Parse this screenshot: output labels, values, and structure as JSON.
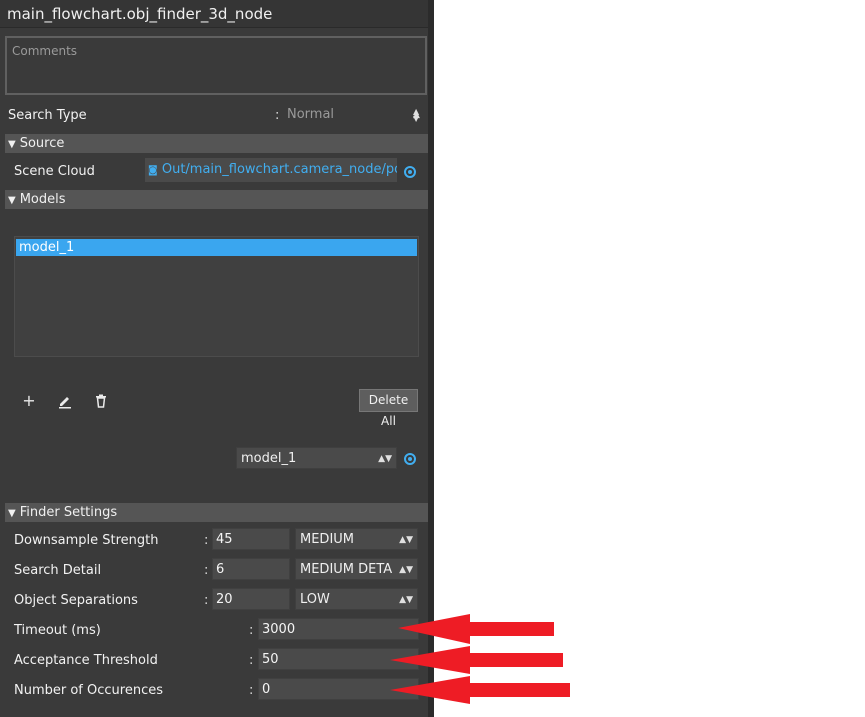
{
  "window": {
    "title": "main_flowchart.obj_finder_3d_node"
  },
  "comments": {
    "placeholder": "Comments"
  },
  "search_type": {
    "label": "Search Type",
    "value": "Normal"
  },
  "source": {
    "section_label": "Source",
    "scene_cloud": {
      "label": "Scene Cloud",
      "value": "Out/main_flowchart.camera_node/pointC"
    }
  },
  "models": {
    "section_label": "Models",
    "items": [
      "model_1"
    ],
    "delete_all_label": "Delete All",
    "selected_model": "model_1"
  },
  "finder_settings": {
    "section_label": "Finder Settings",
    "downsample_strength": {
      "label": "Downsample Strength",
      "value": "45",
      "level": "MEDIUM"
    },
    "search_detail": {
      "label": "Search Detail",
      "value": "6",
      "level": "MEDIUM DETA"
    },
    "object_separations": {
      "label": "Object Separations",
      "value": "20",
      "level": "LOW"
    },
    "timeout": {
      "label": "Timeout (ms)",
      "value": "3000"
    },
    "acceptance_threshold": {
      "label": "Acceptance Threshold",
      "value": "50"
    },
    "number_of_occurences": {
      "label": "Number of Occurences",
      "value": "0"
    }
  },
  "colors": {
    "panel_bg": "#3a3a3a",
    "section_bg": "#555555",
    "accent": "#41aef0",
    "selection": "#3aa6ef",
    "annotation_arrow": "#ee1c25"
  },
  "icons": {
    "add": "plus-icon",
    "edit": "pencil-icon",
    "delete": "trash-icon",
    "link": "camera-icon",
    "target": "target-icon",
    "expand": "triangle-down-icon"
  }
}
